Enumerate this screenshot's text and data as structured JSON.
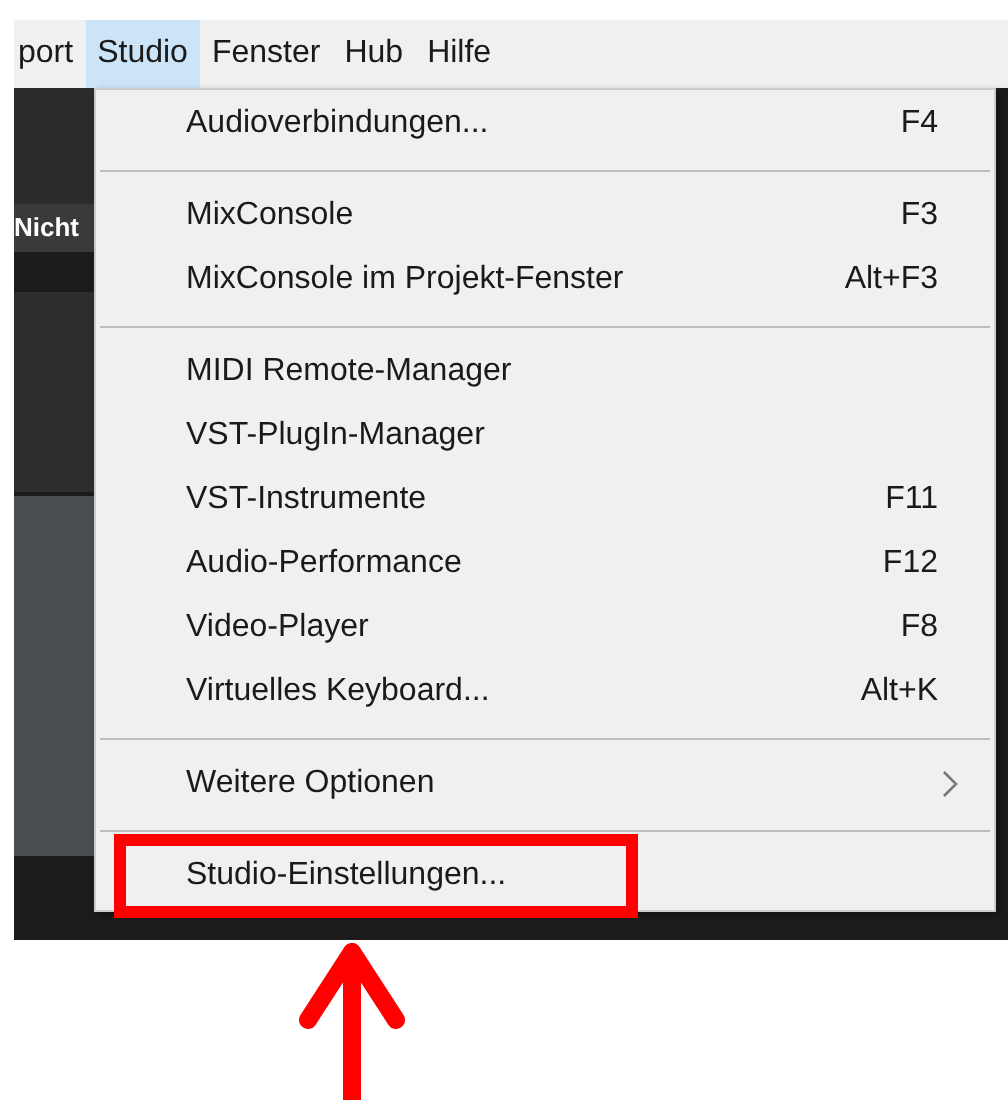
{
  "menubar": [
    {
      "label": "port",
      "selected": false
    },
    {
      "label": "Studio",
      "selected": true
    },
    {
      "label": "Fenster",
      "selected": false
    },
    {
      "label": "Hub",
      "selected": false
    },
    {
      "label": "Hilfe",
      "selected": false
    }
  ],
  "background_label": "Nicht",
  "menu": [
    {
      "kind": "item",
      "label": "Audioverbindungen...",
      "shortcut": "F4",
      "highlighted": false
    },
    {
      "kind": "separator"
    },
    {
      "kind": "item",
      "label": "MixConsole",
      "shortcut": "F3",
      "highlighted": false
    },
    {
      "kind": "item",
      "label": "MixConsole im Projekt-Fenster",
      "shortcut": "Alt+F3",
      "highlighted": false
    },
    {
      "kind": "separator"
    },
    {
      "kind": "item",
      "label": "MIDI Remote-Manager",
      "highlighted": false
    },
    {
      "kind": "item",
      "label": "VST-PlugIn-Manager",
      "highlighted": false
    },
    {
      "kind": "item",
      "label": "VST-Instrumente",
      "shortcut": "F11",
      "highlighted": false
    },
    {
      "kind": "item",
      "label": "Audio-Performance",
      "shortcut": "F12",
      "highlighted": false
    },
    {
      "kind": "item",
      "label": "Video-Player",
      "shortcut": "F8",
      "highlighted": false
    },
    {
      "kind": "item",
      "label": "Virtuelles Keyboard...",
      "shortcut": "Alt+K",
      "highlighted": false
    },
    {
      "kind": "separator"
    },
    {
      "kind": "submenu",
      "label": "Weitere Optionen",
      "highlighted": false
    },
    {
      "kind": "separator"
    },
    {
      "kind": "item",
      "label": "Studio-Einstellungen...",
      "highlighted": true
    }
  ]
}
